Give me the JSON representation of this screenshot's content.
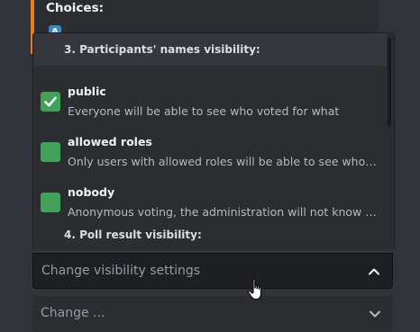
{
  "embed": {
    "title": "Choices:",
    "first_choice_text": "",
    "first_choice_icon": "regional-indicator-a",
    "accent_color": "#e67e22"
  },
  "dropdown": {
    "groups": [
      {
        "label": "3. Participants' names visibility:"
      },
      {
        "label": "4. Poll result visibility:"
      }
    ],
    "options": [
      {
        "label": "public",
        "description": "Everyone will be able to see who voted for what",
        "checked": true
      },
      {
        "label": "allowed roles",
        "description": "Only users with allowed roles will be able to see who voted for what",
        "checked": false
      },
      {
        "label": "nobody",
        "description": "Anonymous voting, the administration will not know who voted for what",
        "checked": false
      }
    ]
  },
  "select": {
    "placeholder": "Change visibility settings",
    "icon": "chevron-up-icon"
  },
  "next_select": {
    "placeholder": "Change ..."
  },
  "colors": {
    "checkbox": "#43a25a",
    "panel": "#2b2d31",
    "background": "#313338"
  }
}
